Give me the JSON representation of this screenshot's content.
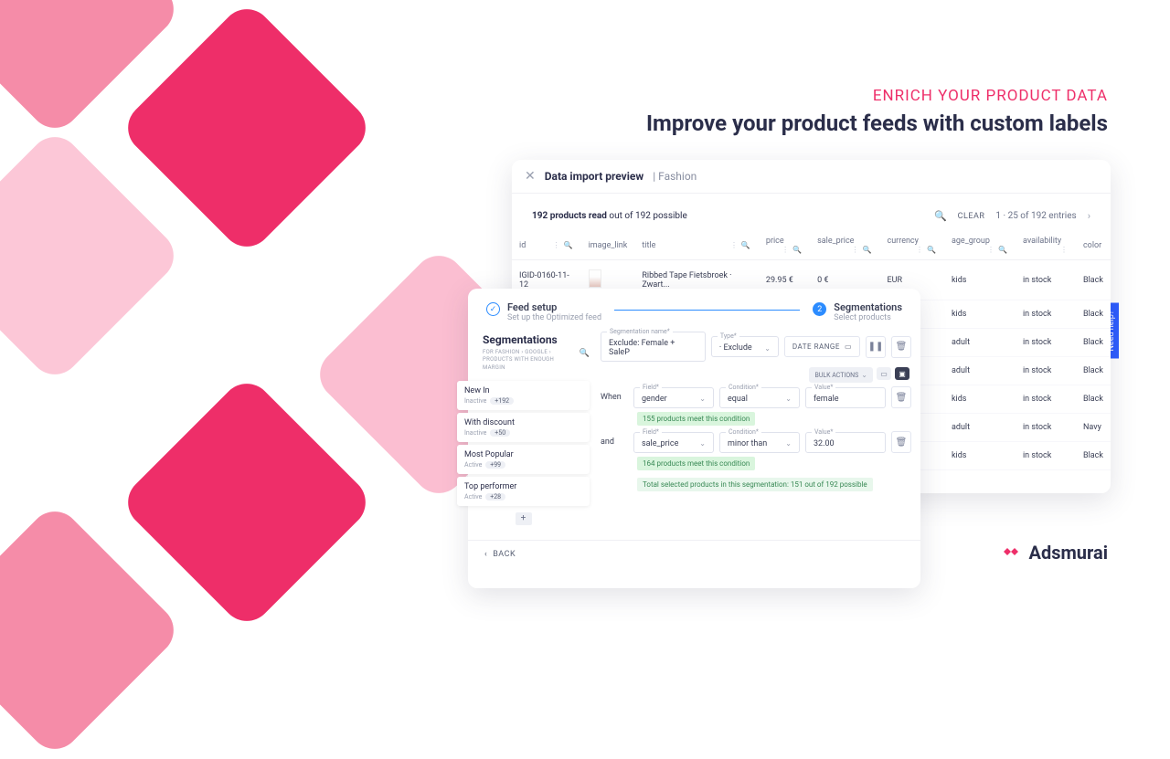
{
  "heading": {
    "kicker": "ENRICH YOUR PRODUCT DATA",
    "title": "Improve your product feeds with custom labels"
  },
  "brand": {
    "name": "Adsmurai"
  },
  "help": {
    "label": "Need help?"
  },
  "preview": {
    "title": "Data import preview",
    "context": "Fashion",
    "summary_strong": "192 products read",
    "summary_rest": " out of 192 possible",
    "clear": "CLEAR",
    "pagination": "1 · 25 of 192 entries",
    "cols": [
      "id",
      "image_link",
      "title",
      "price",
      "sale_price",
      "currency",
      "age_group",
      "availability",
      "color"
    ],
    "rows": [
      {
        "id": "IGID-0160-11-12",
        "title": "Ribbed Tape Fietsbroek · Zwart...",
        "price": "29.95 €",
        "sale": "0 €",
        "cur": "EUR",
        "age": "kids",
        "avail": "in stock",
        "color": "Black"
      },
      {
        "age": "kids",
        "avail": "in stock",
        "color": "Black"
      },
      {
        "age": "adult",
        "avail": "in stock",
        "color": "Black"
      },
      {
        "age": "adult",
        "avail": "in stock",
        "color": "Black"
      },
      {
        "age": "kids",
        "avail": "in stock",
        "color": "Black"
      },
      {
        "age": "adult",
        "avail": "in stock",
        "color": "Navy"
      },
      {
        "age": "kids",
        "avail": "in stock",
        "color": "Black"
      }
    ]
  },
  "seg": {
    "steps": {
      "s1_title": "Feed setup",
      "s1_sub": "Set up the Optimized feed",
      "s2_num": "2",
      "s2_title": "Segmentations",
      "s2_sub": "Select products"
    },
    "heading": "Segmentations",
    "breadcrumb": "FOR FASHION › GOOGLE › PRODUCTS WITH ENOUGH MARGIN",
    "items": [
      {
        "name": "New In",
        "status": "Inactive",
        "count": "+192"
      },
      {
        "name": "With discount",
        "status": "Inactive",
        "count": "+50"
      },
      {
        "name": "Most Popular",
        "status": "Active",
        "count": "+99"
      },
      {
        "name": "Top performer",
        "status": "Active",
        "count": "+28"
      }
    ],
    "form": {
      "name_label": "Segmentation name*",
      "name_val": "Exclude: Female + SaleP",
      "type_label": "Type*",
      "type_val": "· Exclude",
      "date_range": "DATE RANGE",
      "bulk": "BULK ACTIONS",
      "when": "When",
      "and": "and",
      "field_lbl": "Field*",
      "cond_lbl": "Condition*",
      "val_lbl": "Value*",
      "c1_field": "gender",
      "c1_cond": "equal",
      "c1_val": "female",
      "c1_hint": "155 products meet this condition",
      "c2_field": "sale_price",
      "c2_cond": "minor than",
      "c2_val": "32.00",
      "c2_hint": "164 products meet this condition",
      "total": "Total selected products in this segmentation: 151 out of 192 possible"
    },
    "back": "BACK"
  }
}
